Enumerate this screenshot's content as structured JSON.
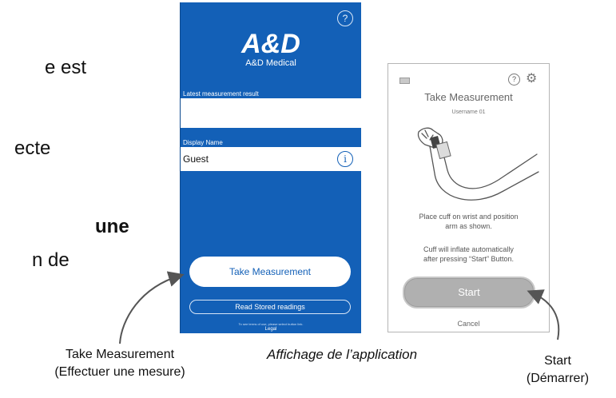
{
  "document_text": {
    "line1": "e  est",
    "line2": "ecte",
    "line3": "une",
    "line4": "n  de"
  },
  "app_screen": {
    "help_icon": "?",
    "logo_text": "A&D",
    "brand": "A&D Medical",
    "latest_label": "Latest measurement result",
    "display_name_label": "Display Name",
    "display_name_value": "Guest",
    "info_icon": "i",
    "take_button": "Take Measurement",
    "read_button": "Read Stored readings",
    "terms_text": "To see terms of use, please select button link.",
    "legal": "Legal",
    "colors": {
      "background": "#1360b7",
      "button_text": "#1360b7"
    }
  },
  "measure_screen": {
    "help_icon": "?",
    "settings_icon": "gear-icon",
    "battery_icon": "battery-icon",
    "title": "Take Measurement",
    "username": "Username 01",
    "instruction1_line1": "Place cuff on wrist and position",
    "instruction1_line2": "arm as shown.",
    "instruction2_line1": "Cuff will inflate automatically",
    "instruction2_line2": "after pressing “Start” Button.",
    "start_button": "Start",
    "cancel": "Cancel"
  },
  "captions": {
    "take_line1": "Take Measurement",
    "take_line2": "(Effectuer une mesure)",
    "app_display": "Affichage de l’application",
    "start_line1": "Start",
    "start_line2": "(Démarrer)"
  }
}
